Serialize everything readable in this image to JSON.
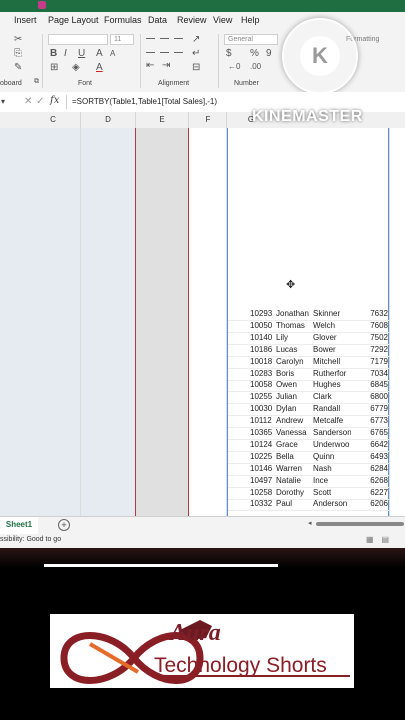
{
  "menu": [
    "Insert",
    "Page Layout",
    "Formulas",
    "Data",
    "Review",
    "View",
    "Help"
  ],
  "ribbon": {
    "groups": [
      "oboard",
      "Font",
      "Alignment",
      "Number"
    ],
    "number_format": "General",
    "font_size": "11",
    "cond_format_label": "Formatting"
  },
  "formula_bar": {
    "formula": "=SORTBY(Table1,Table1[Total Sales],-1)"
  },
  "columns": [
    "C",
    "D",
    "E",
    "F",
    "G"
  ],
  "rows": [
    {
      "id": "10293",
      "first": "Jonathan",
      "last": "Skinner",
      "sales": "7632"
    },
    {
      "id": "10050",
      "first": "Thomas",
      "last": "Welch",
      "sales": "7608"
    },
    {
      "id": "10140",
      "first": "Lily",
      "last": "Glover",
      "sales": "7502"
    },
    {
      "id": "10186",
      "first": "Lucas",
      "last": "Bower",
      "sales": "7292"
    },
    {
      "id": "10018",
      "first": "Carolyn",
      "last": "Mitchell",
      "sales": "7179"
    },
    {
      "id": "10283",
      "first": "Boris",
      "last": "Rutherfor",
      "sales": "7034"
    },
    {
      "id": "10058",
      "first": "Owen",
      "last": "Hughes",
      "sales": "6845"
    },
    {
      "id": "10255",
      "first": "Julian",
      "last": "Clark",
      "sales": "6800"
    },
    {
      "id": "10030",
      "first": "Dylan",
      "last": "Randall",
      "sales": "6779"
    },
    {
      "id": "10112",
      "first": "Andrew",
      "last": "Metcalfe",
      "sales": "6773"
    },
    {
      "id": "10365",
      "first": "Vanessa",
      "last": "Sanderson",
      "sales": "6765"
    },
    {
      "id": "10124",
      "first": "Grace",
      "last": "Underwoo",
      "sales": "6642"
    },
    {
      "id": "10225",
      "first": "Bella",
      "last": "Quinn",
      "sales": "6493"
    },
    {
      "id": "10146",
      "first": "Warren",
      "last": "Nash",
      "sales": "6284"
    },
    {
      "id": "10497",
      "first": "Natalie",
      "last": "Ince",
      "sales": "6268"
    },
    {
      "id": "10258",
      "first": "Dorothy",
      "last": "Scott",
      "sales": "6227"
    },
    {
      "id": "10332",
      "first": "Paul",
      "last": "Anderson",
      "sales": "6206"
    }
  ],
  "sheet_tab": "Sheet1",
  "status": "ssibility: Good to go",
  "watermark": "KINEMASTER",
  "brand": {
    "line1": "Aura",
    "line2": "Technology Shorts"
  },
  "colors": {
    "excel_green": "#1e7145",
    "brand_red": "#8a1e25"
  }
}
